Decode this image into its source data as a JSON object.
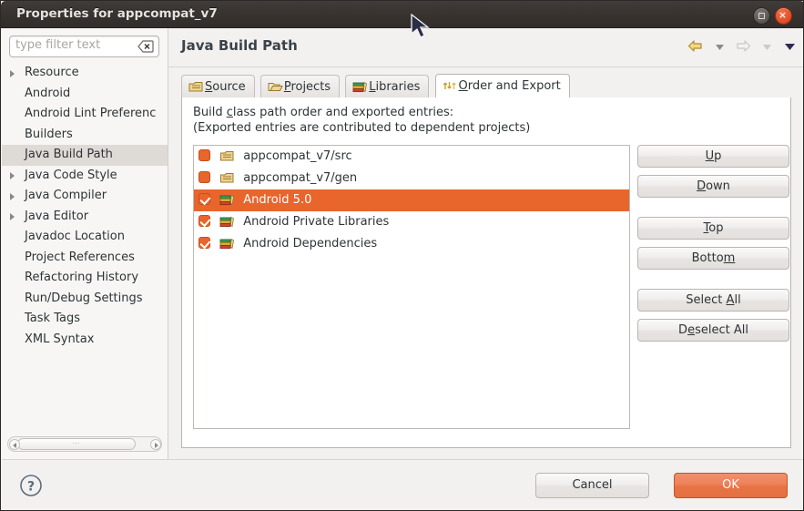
{
  "window": {
    "title": "Properties for appcompat_v7",
    "controls": {
      "maximize": "maximize-icon",
      "close": "×"
    }
  },
  "sidebar": {
    "filter": {
      "value": "",
      "placeholder": "type filter text",
      "clear_icon": "clear-icon"
    },
    "items": [
      {
        "label": "Resource",
        "expandable": true,
        "selected": false
      },
      {
        "label": "Android",
        "expandable": false,
        "selected": false
      },
      {
        "label": "Android Lint Preferenc",
        "expandable": false,
        "selected": false
      },
      {
        "label": "Builders",
        "expandable": false,
        "selected": false
      },
      {
        "label": "Java Build Path",
        "expandable": false,
        "selected": true
      },
      {
        "label": "Java Code Style",
        "expandable": true,
        "selected": false
      },
      {
        "label": "Java Compiler",
        "expandable": true,
        "selected": false
      },
      {
        "label": "Java Editor",
        "expandable": true,
        "selected": false
      },
      {
        "label": "Javadoc Location",
        "expandable": false,
        "selected": false
      },
      {
        "label": "Project References",
        "expandable": false,
        "selected": false
      },
      {
        "label": "Refactoring History",
        "expandable": false,
        "selected": false
      },
      {
        "label": "Run/Debug Settings",
        "expandable": false,
        "selected": false
      },
      {
        "label": "Task Tags",
        "expandable": false,
        "selected": false
      },
      {
        "label": "XML Syntax",
        "expandable": false,
        "selected": false
      }
    ]
  },
  "header": {
    "page_title": "Java Build Path",
    "nav": [
      {
        "icon": "back-arrow-icon",
        "enabled": true
      },
      {
        "icon": "chevron-down-icon",
        "enabled": true
      },
      {
        "icon": "forward-arrow-icon",
        "enabled": false
      },
      {
        "icon": "chevron-down-icon",
        "enabled": false
      },
      {
        "icon": "chevron-down-icon",
        "enabled": true
      }
    ]
  },
  "tabs": [
    {
      "label": "Source",
      "mnemonic": "S",
      "icon": "package-folder-icon",
      "active": false
    },
    {
      "label": "Projects",
      "mnemonic": "P",
      "icon": "open-folder-icon",
      "active": false
    },
    {
      "label": "Libraries",
      "mnemonic": "L",
      "icon": "books-icon",
      "active": false
    },
    {
      "label": "Order and Export",
      "mnemonic": "O",
      "icon": "order-arrows-icon",
      "active": true
    }
  ],
  "panel": {
    "description_line1_pre": "Build ",
    "description_line1_mnemonic": "c",
    "description_line1_post": "lass path order and exported entries:",
    "description_line2": "(Exported entries are contributed to dependent projects)",
    "entries": [
      {
        "label": "appcompat_v7/src",
        "checked": false,
        "selected": false,
        "icon": "package-folder-icon"
      },
      {
        "label": "appcompat_v7/gen",
        "checked": false,
        "selected": false,
        "icon": "package-folder-icon"
      },
      {
        "label": "Android 5.0",
        "checked": true,
        "selected": true,
        "icon": "books-icon"
      },
      {
        "label": "Android Private Libraries",
        "checked": true,
        "selected": false,
        "icon": "books-icon"
      },
      {
        "label": "Android Dependencies",
        "checked": true,
        "selected": false,
        "icon": "books-icon"
      }
    ],
    "buttons": [
      {
        "label": "Up",
        "mnemonic": "U"
      },
      {
        "label": "Down",
        "mnemonic": "D"
      },
      {
        "label": "Top",
        "mnemonic": "T"
      },
      {
        "label": "Bottom",
        "mnemonic": "m"
      },
      {
        "label": "Select All",
        "mnemonic": "A"
      },
      {
        "label": "Deselect All",
        "mnemonic": "e"
      }
    ]
  },
  "footer": {
    "help_icon": "help-icon",
    "cancel_label": "Cancel",
    "ok_label": "OK"
  },
  "colors": {
    "accent": "#e8652c",
    "titlebar": "#38332f",
    "selection": "#dedad6",
    "ok_button": "#ec7b50"
  }
}
